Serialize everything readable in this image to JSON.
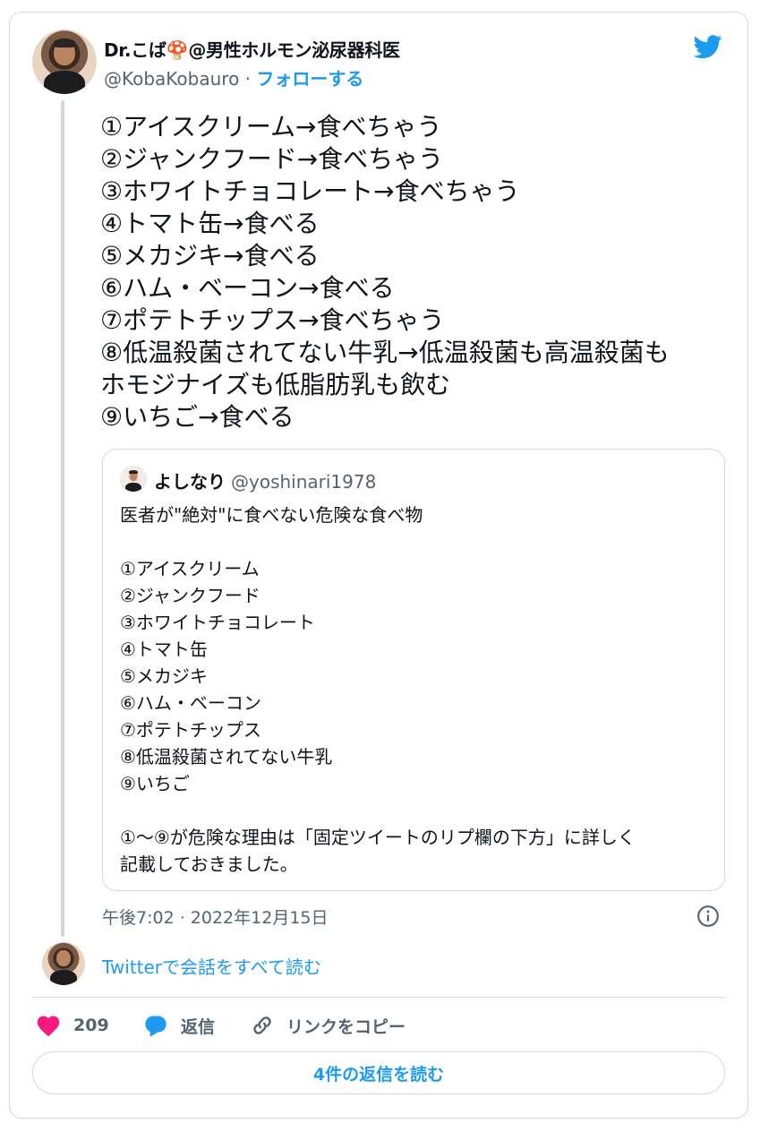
{
  "author": {
    "display_name": "Dr.こば🍄@男性ホルモン泌尿器科医",
    "handle": "@KobaKobauro",
    "separator": " · ",
    "follow_label": "フォローする"
  },
  "tweet": {
    "lines": [
      "①アイスクリーム→食べちゃう",
      "②ジャンクフード→食べちゃう",
      "③ホワイトチョコレート→食べちゃう",
      "④トマト缶→食べる",
      "⑤メカジキ→食べる",
      "⑥ハム・ベーコン→食べる",
      "⑦ポテトチップス→食べちゃう",
      "⑧低温殺菌されてない牛乳→低温殺菌も高温殺菌も",
      "ホモジナイズも低脂肪乳も飲む",
      "⑨いちご→食べる"
    ]
  },
  "quote": {
    "display_name": "よしなり",
    "handle": "@yoshinari1978",
    "lines": [
      "医者が\"絶対\"に食べない危険な食べ物",
      "",
      "①アイスクリーム",
      "②ジャンクフード",
      "③ホワイトチョコレート",
      "④トマト缶",
      "⑤メカジキ",
      "⑥ハム・ベーコン",
      "⑦ポテトチップス",
      "⑧低温殺菌されてない牛乳",
      "⑨いちご",
      "",
      "①〜⑨が危険な理由は「固定ツイートのリプ欄の下方」に詳しく",
      "記載しておきました。"
    ]
  },
  "meta": {
    "timestamp": "午後7:02 · 2022年12月15日"
  },
  "conversation": {
    "label": "Twitterで会話をすべて読む"
  },
  "actions": {
    "like_count": "209",
    "reply_label": "返信",
    "copy_link_label": "リンクをコピー"
  },
  "replies_button": {
    "label": "4件の返信を読む"
  },
  "colors": {
    "accent": "#1d9bf0",
    "like": "#f91880",
    "muted": "#536471",
    "border": "#cfd9de"
  }
}
